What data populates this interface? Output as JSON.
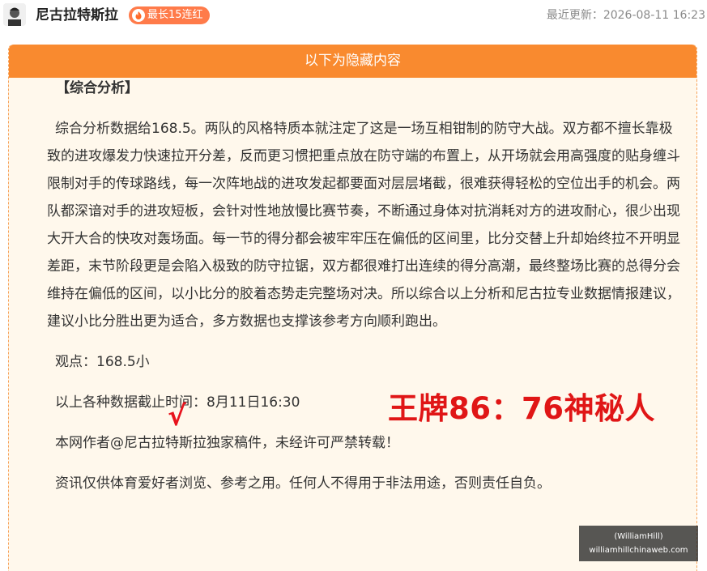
{
  "header": {
    "author_name": "尼古拉特斯拉",
    "streak_badge": "最长15连红",
    "updated_label": "最近更新：2026-08-11 16:23"
  },
  "hidden_box": {
    "title": "以下为隐藏内容"
  },
  "article": {
    "section_title": "【综合分析】",
    "paragraph": "综合分析数据给168.5。两队的风格特质本就注定了这是一场互相钳制的防守大战。双方都不擅长靠极致的进攻爆发力快速拉开分差，反而更习惯把重点放在防守端的布置上，从开场就会用高强度的贴身缠斗限制对手的传球路线，每一次阵地战的进攻发起都要面对层层堵截，很难获得轻松的空位出手的机会。两队都深谙对手的进攻短板，会针对性地放慢比赛节奏，不断通过身体对抗消耗对方的进攻耐心，很少出现大开大合的快攻对轰场面。每一节的得分都会被牢牢压在偏低的区间里，比分交替上升却始终拉不开明显差距，末节阶段更是会陷入极致的防守拉锯，双方都很难打出连续的得分高潮，最终整场比赛的总得分会维持在偏低的区间，以小比分的胶着态势走完整场对决。所以综合以上分析和尼古拉专业数据情报建议，建议小比分胜出更为适合，多方数据也支撑该参考方向顺利跑出。",
    "viewpoint": "观点：168.5小",
    "check_mark": "√",
    "score_text": "王牌86：76神秘人",
    "deadline": "以上各种数据截止时间：8月11日16:30",
    "copyright": "本网作者@尼古拉特斯拉独家稿件，未经许可严禁转载！",
    "disclaimer": "资讯仅供体育爱好者浏览、参考之用。任何人不得用于非法用途，否则责任自负。"
  },
  "watermark": {
    "line1": "(WilliamHill)",
    "line2": "williamhillchinaweb.com"
  },
  "colors": {
    "orange_header": "#f98a2f",
    "badge": "#ff7b4a",
    "box_bg": "#fff8ec",
    "red_text": "#e01616"
  }
}
